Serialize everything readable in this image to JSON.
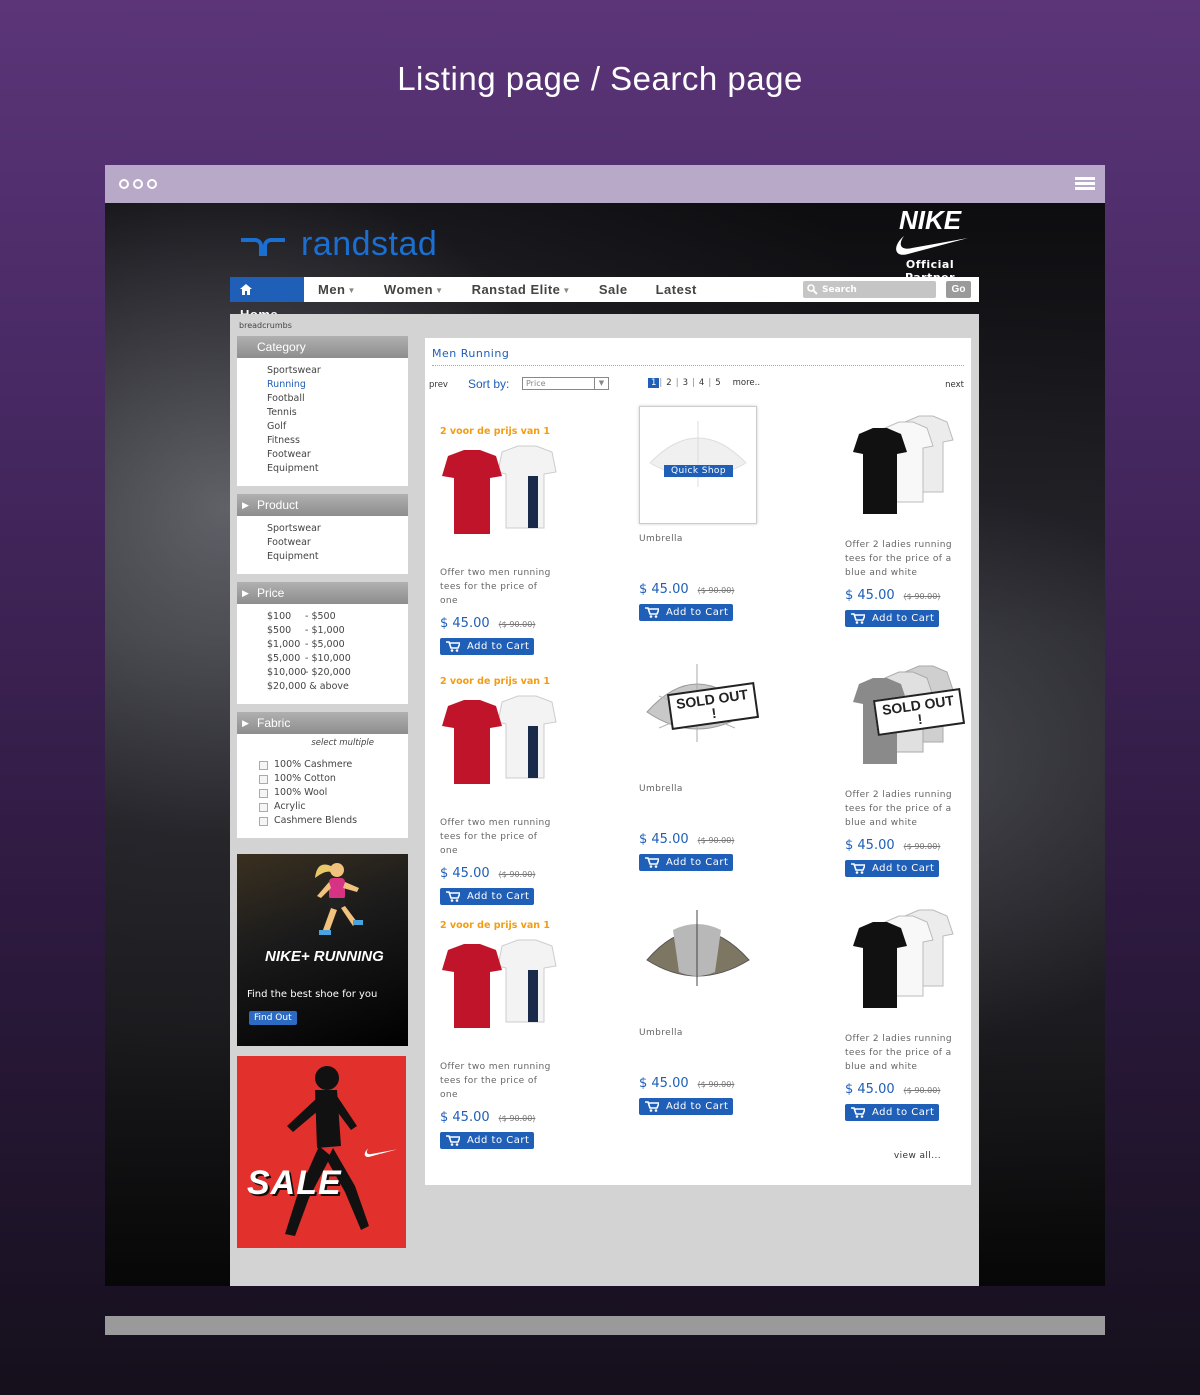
{
  "headline": "Listing page / Search page",
  "site": {
    "logo": "randstad",
    "partner_brand": "NIKE",
    "partner_caption": "Official Partner"
  },
  "nav": {
    "home": "Home",
    "items": [
      "Men",
      "Women",
      "Ranstad Elite",
      "Sale",
      "Latest"
    ],
    "search_placeholder": "Search",
    "go": "Go"
  },
  "breadcrumbs": "breadcrumbs",
  "sidebar": {
    "category": {
      "title": "Category",
      "items": [
        "Sportswear",
        "Running",
        "Football",
        "Tennis",
        "Golf",
        "Fitness",
        "Footwear",
        "Equipment"
      ],
      "active": "Running"
    },
    "product": {
      "title": "Product",
      "items": [
        "Sportswear",
        "Footwear",
        "Equipment"
      ]
    },
    "price": {
      "title": "Price",
      "ranges": [
        [
          "$100",
          "- $500"
        ],
        [
          "$500",
          "- $1,000"
        ],
        [
          "$1,000",
          "- $5,000"
        ],
        [
          "$5,000",
          "- $10,000"
        ],
        [
          "$10,000",
          "- $20,000"
        ],
        [
          "$20,000 & above",
          ""
        ]
      ]
    },
    "fabric": {
      "title": "Fabric",
      "hint": "select multiple",
      "options": [
        "100% Cashmere",
        "100% Cotton",
        "100% Wool",
        "Acrylic",
        "Cashmere Blends"
      ]
    },
    "promo_running": {
      "title": "NIKE+ RUNNING",
      "subtitle": "Find the best shoe for you",
      "button": "Find Out"
    },
    "promo_sale": {
      "title": "SALE"
    }
  },
  "main": {
    "title": "Men Running",
    "prev": "prev",
    "next": "next",
    "sort_label": "Sort by:",
    "sort_value": "Price",
    "pages": [
      "1",
      "2",
      "3",
      "4",
      "5"
    ],
    "more": "more..",
    "view_all": "view all...",
    "quick_shop": "Quick Shop",
    "sold_out": "SOLD OUT !",
    "add_to_cart": "Add to Cart",
    "offer_label": "2 voor de prijs van 1",
    "products": [
      {
        "desc": "Offer two men running tees for the price of one",
        "price": "$ 45.00",
        "old_price": "($ 90.00)"
      },
      {
        "desc": "Umbrella",
        "price": "$ 45.00",
        "old_price": "($ 90.00)"
      },
      {
        "desc": "Offer 2 ladies running tees for the price of a blue and white",
        "price": "$ 45.00",
        "old_price": "($ 90.00)"
      },
      {
        "desc": "Offer two men running tees for the price of one",
        "price": "$ 45.00",
        "old_price": "($ 90.00)"
      },
      {
        "desc": "Umbrella",
        "price": "$ 45.00",
        "old_price": "($ 90.00)"
      },
      {
        "desc": "Offer 2 ladies running tees for the price of a blue and white",
        "price": "$ 45.00",
        "old_price": "($ 90.00)"
      },
      {
        "desc": "Offer two men running tees for the price of one",
        "price": "$ 45.00",
        "old_price": "($ 90.00)"
      },
      {
        "desc": "Umbrella",
        "price": "$ 45.00",
        "old_price": "($ 90.00)"
      },
      {
        "desc": "Offer 2 ladies running tees for the price of a blue and white",
        "price": "$ 45.00",
        "old_price": "($ 90.00)"
      }
    ]
  },
  "colors": {
    "accent": "#1f5fb8",
    "offer": "#f39c12",
    "sale": "#e2312c"
  }
}
